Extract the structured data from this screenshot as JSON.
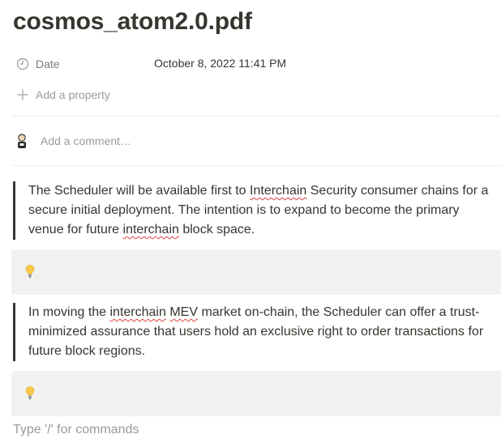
{
  "page": {
    "title": "cosmos_atom2.0.pdf"
  },
  "properties": {
    "date": {
      "icon": "clock-icon",
      "label": "Date",
      "value": "October 8, 2022 11:41 PM"
    },
    "add_property": {
      "icon": "plus-icon",
      "label": "Add a property"
    }
  },
  "comment": {
    "avatar": "avatar",
    "placeholder": "Add a comment…"
  },
  "blocks": {
    "quote1": {
      "parts": [
        "The Scheduler will be available first to ",
        "Interchain",
        " Security consumer chains for a secure initial deployment. The intention is to expand to become the primary venue for future ",
        "interchain",
        " block space."
      ]
    },
    "callout1": {
      "icon": "lightbulb-icon"
    },
    "quote2": {
      "parts": [
        "In moving the ",
        "interchain",
        " ",
        "MEV",
        " market on-chain, the Scheduler can offer a trust-minimized assurance that users hold an exclusive right to order transactions for future block regions."
      ]
    },
    "callout2": {
      "icon": "lightbulb-icon"
    }
  },
  "editor": {
    "placeholder": "Type '/' for commands"
  },
  "colors": {
    "text": "#37352f",
    "callout_bg": "#f1f1ef",
    "spellcheck": "#e03e3e",
    "quote_bar": "#37352f"
  }
}
